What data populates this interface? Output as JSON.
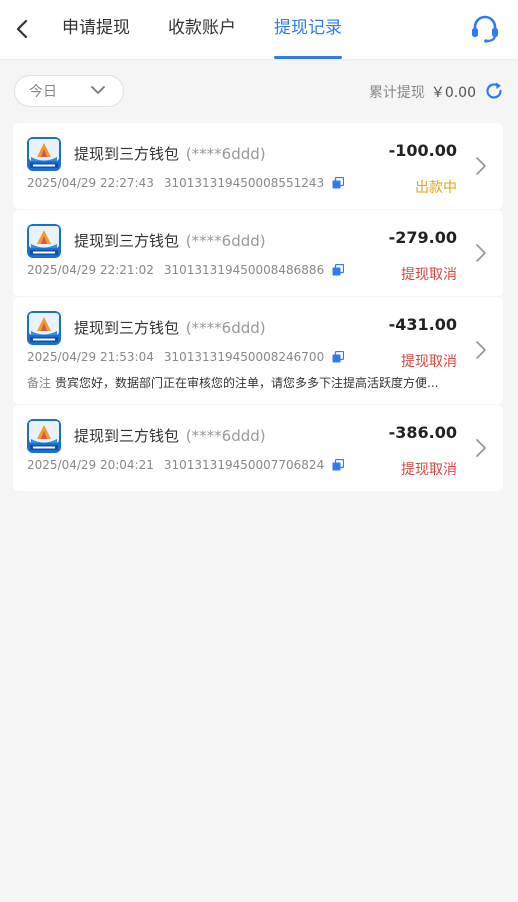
{
  "header": {
    "back_icon": "chevron-left-icon",
    "tabs": [
      {
        "label": "申请提现",
        "active": false
      },
      {
        "label": "收款账户",
        "active": false
      },
      {
        "label": "提现记录",
        "active": true
      }
    ],
    "support_icon": "headset-icon",
    "accent_color": "#2f7bf0"
  },
  "filter": {
    "date_value": "今日",
    "dropdown_icon": "chevron-down-icon",
    "total_label": "累计提现",
    "total_amount": "￥0.00",
    "refresh_icon": "refresh-icon"
  },
  "records": [
    {
      "title": "提现到三方钱包",
      "account": "(****6ddd)",
      "time": "2025/04/29 22:27:43",
      "order_no": "310131319450008551243",
      "amount": "-100.00",
      "status": "出款中",
      "status_color": "#e8a317",
      "note_label": "",
      "note": ""
    },
    {
      "title": "提现到三方钱包",
      "account": "(****6ddd)",
      "time": "2025/04/29 22:21:02",
      "order_no": "310131319450008486886",
      "amount": "-279.00",
      "status": "提现取消",
      "status_color": "#e0443e",
      "note_label": "",
      "note": ""
    },
    {
      "title": "提现到三方钱包",
      "account": "(****6ddd)",
      "time": "2025/04/29 21:53:04",
      "order_no": "310131319450008246700",
      "amount": "-431.00",
      "status": "提现取消",
      "status_color": "#e0443e",
      "note_label": "备注",
      "note": "贵宾您好，数据部门正在审核您的注单，请您多多下注提高活跃度方便..."
    },
    {
      "title": "提现到三方钱包",
      "account": "(****6ddd)",
      "time": "2025/04/29 20:04:21",
      "order_no": "310131319450007706824",
      "amount": "-386.00",
      "status": "提现取消",
      "status_color": "#e0443e",
      "note_label": "",
      "note": ""
    }
  ]
}
